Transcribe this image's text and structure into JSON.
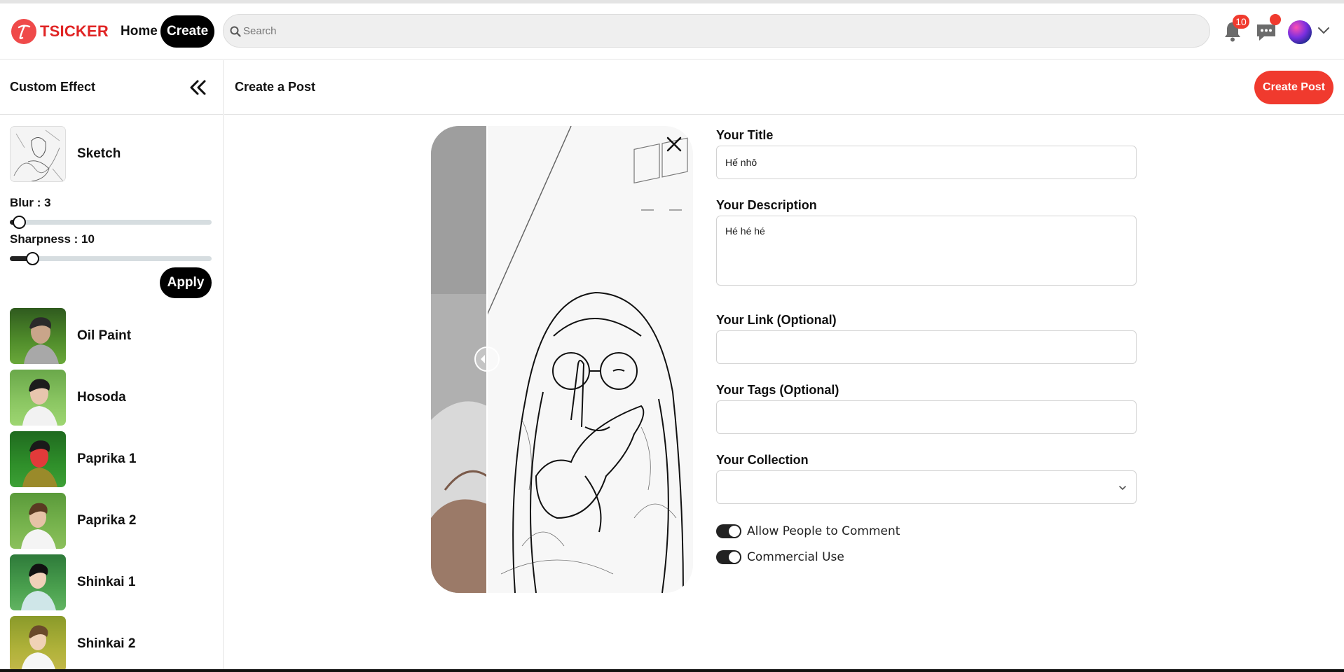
{
  "brand": {
    "name": "TSICKER",
    "accent": "#e02424"
  },
  "nav": {
    "home": "Home",
    "create": "Create"
  },
  "search": {
    "placeholder": "Search",
    "value": ""
  },
  "header": {
    "notification_count": "10",
    "notification_icon": "bell-icon",
    "message_icon": "chat-icon"
  },
  "sidebar": {
    "title": "Custom Effect",
    "selected_effect": "Sketch",
    "blur": {
      "label": "Blur : 3",
      "value": 3
    },
    "sharpness": {
      "label": "Sharpness : 10",
      "value": 10
    },
    "apply_label": "Apply",
    "effects": [
      {
        "label": "Oil Paint"
      },
      {
        "label": "Hosoda"
      },
      {
        "label": "Paprika 1"
      },
      {
        "label": "Paprika 2"
      },
      {
        "label": "Shinkai 1"
      },
      {
        "label": "Shinkai 2"
      }
    ]
  },
  "main": {
    "title": "Create a Post",
    "create_button": "Create Post",
    "form": {
      "title_label": "Your Title",
      "title_value": "Hế nhô",
      "description_label": "Your Description",
      "description_value": "Hé hé hé",
      "link_label": "Your Link (Optional)",
      "link_value": "",
      "tags_label": "Your Tags (Optional)",
      "tags_value": "",
      "collection_label": "Your Collection",
      "collection_value": "",
      "allow_comment_label": "Allow People to Comment",
      "allow_comment_on": true,
      "commercial_label": "Commercial Use",
      "commercial_on": true
    }
  },
  "colors": {
    "primary_red": "#f03a2e",
    "dark": "#000000"
  }
}
